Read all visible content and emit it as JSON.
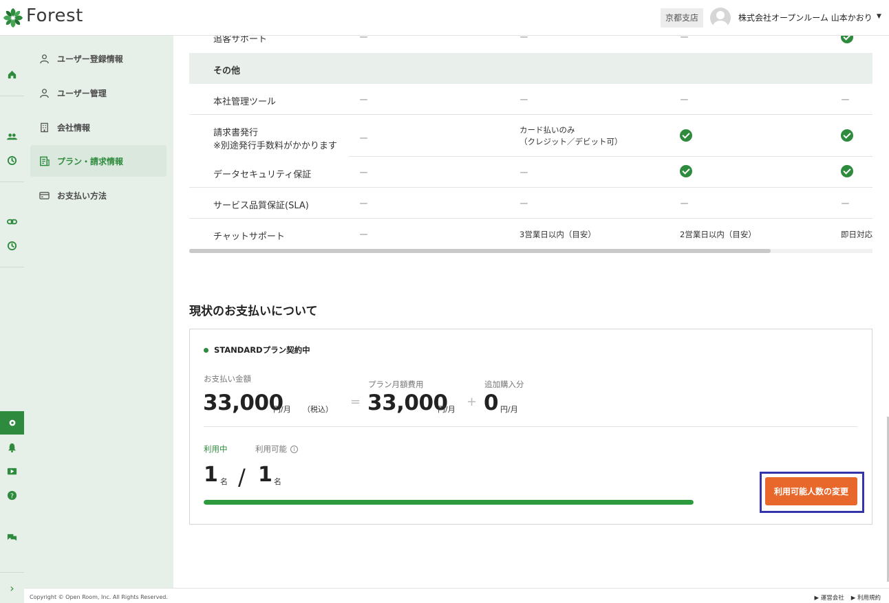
{
  "header": {
    "logo_text": "Forest",
    "branch": "京都支店",
    "user_name": "株式会社オープンルーム 山本かおり",
    "caret": "▼"
  },
  "subnav": {
    "items": [
      {
        "label": "ユーザー登録情報",
        "icon": "person-icon"
      },
      {
        "label": "ユーザー管理",
        "icon": "person-icon"
      },
      {
        "label": "会社情報",
        "icon": "building-icon"
      },
      {
        "label": "プラン・請求情報",
        "icon": "invoice-icon",
        "active": true
      },
      {
        "label": "お支払い方法",
        "icon": "card-icon"
      }
    ]
  },
  "table": {
    "dash": "ー",
    "row_top": {
      "label": "追客サポート"
    },
    "section_other": "その他",
    "rows": [
      {
        "label": "本社管理ツール"
      },
      {
        "label": "請求書発行",
        "note": "※別途発行手数料がかかります",
        "col2_line1": "カード払いのみ",
        "col2_line2": "（クレジット／デビット可）"
      },
      {
        "label": "データセキュリティ保証"
      },
      {
        "label": "サービス品質保証(SLA)"
      },
      {
        "label": "チャットサポート",
        "col2": "3営業日以内（目安）",
        "col3": "2営業日以内（目安）",
        "col4": "即日対応"
      }
    ]
  },
  "payment": {
    "title": "現状のお支払いについて",
    "plan_badge": "STANDARDプラン契約中",
    "amount_label": "お支払い金額",
    "amount": "33,000",
    "amount_unit": "円/月",
    "tax_note": "（税込）",
    "equals": "=",
    "plan_fee_label": "プラン月額費用",
    "plan_fee": "33,000",
    "plan_fee_unit": "円/月",
    "plus": "+",
    "extra_label": "追加購入分",
    "extra": "0",
    "extra_unit": "円/月",
    "using_label": "利用中",
    "available_label": "利用可能",
    "info": "i",
    "using_count": "1",
    "using_unit": "名",
    "slash": "/",
    "available_count": "1",
    "available_unit": "名",
    "usage_fraction": 1.0,
    "change_button": "利用可能人数の変更"
  },
  "footer": {
    "copyright": "Copyright © Open Room, Inc. All Rights Reserved.",
    "link1": "▶ 運営会社",
    "link2": "▶ 利用規約"
  },
  "colors": {
    "accent_green": "#2e8b3d",
    "button_orange": "#e8672a",
    "highlight_outline": "#3333aa"
  }
}
